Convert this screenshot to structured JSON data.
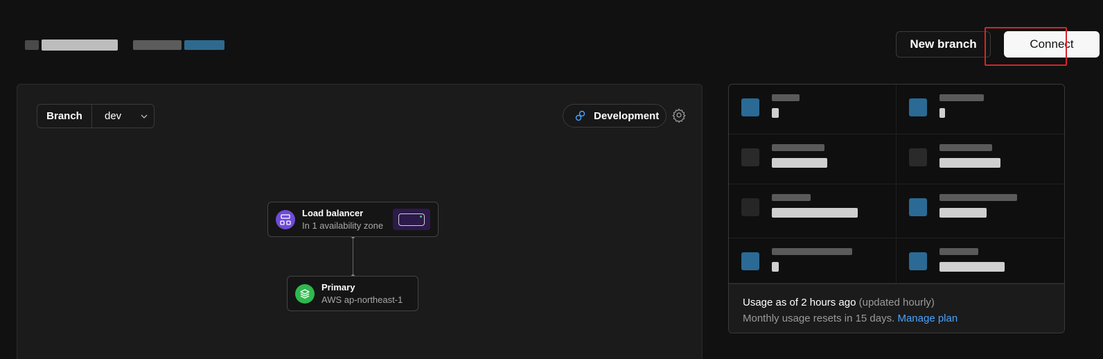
{
  "header": {
    "new_branch_label": "New branch",
    "connect_label": "Connect"
  },
  "branch_selector": {
    "label": "Branch",
    "value": "dev"
  },
  "environment": {
    "label": "Development"
  },
  "nodes": {
    "load_balancer": {
      "title": "Load balancer",
      "subtitle": "In 1 availability zone"
    },
    "primary": {
      "title": "Primary",
      "subtitle": "AWS ap-northeast-1"
    }
  },
  "usage": {
    "title": "Usage as of 2 hours ago",
    "title_note": "(updated hourly)",
    "reset_text": "Monthly usage resets in 15 days.",
    "manage_link": "Manage plan"
  },
  "colors": {
    "accent_blue": "#4aa3ff",
    "highlight_red": "#d6242a",
    "lb_purple": "#6e4bd8",
    "primary_green": "#2fb84e"
  }
}
